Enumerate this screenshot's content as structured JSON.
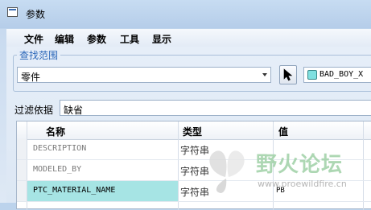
{
  "window": {
    "title": "参数"
  },
  "menu": [
    "文件",
    "编辑",
    "参数",
    "工具",
    "显示"
  ],
  "search_scope": {
    "group_title": "查找范围",
    "type_value": "零件",
    "selection_value": "BAD_BOY_X"
  },
  "filter": {
    "label": "过滤依据",
    "value": "缺省"
  },
  "table": {
    "columns": [
      "名称",
      "类型",
      "值"
    ],
    "rows": [
      {
        "name": "DESCRIPTION",
        "type": "字符串",
        "value": ""
      },
      {
        "name": "MODELED_BY",
        "type": "字符串",
        "value": ""
      },
      {
        "name": "PTC_MATERIAL_NAME",
        "type": "字符串",
        "value": "PB"
      }
    ]
  },
  "watermark": {
    "text": "野火论坛",
    "url": "www.proewildfire.cn"
  }
}
